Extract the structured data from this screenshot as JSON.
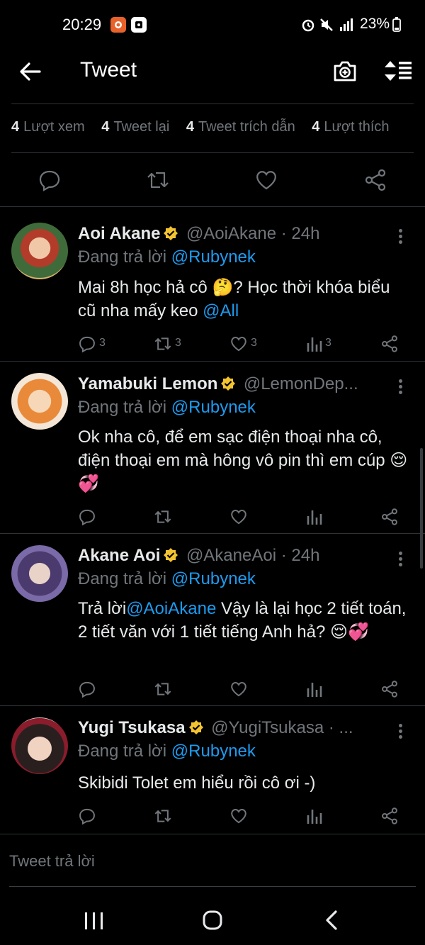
{
  "status_bar": {
    "time": "20:29",
    "battery": "23%"
  },
  "header": {
    "title": "Tweet"
  },
  "stats": [
    {
      "num": "4",
      "label": "Lượt xem"
    },
    {
      "num": "4",
      "label": "Tweet lại"
    },
    {
      "num": "4",
      "label": "Tweet trích dẫn"
    },
    {
      "num": "4",
      "label": "Lượt thích"
    }
  ],
  "replies": [
    {
      "name": "Aoi Akane",
      "handle": "@AoiAkane · 24h",
      "replying_prefix": "Đang trả lời ",
      "replying_to": "@Rubynek",
      "body_1": "Mai 8h học hả cô 🤔?  Học thời khóa biểu cũ nha mấy keo ",
      "body_mention": "@All",
      "reply_count": "3",
      "retweet_count": "3",
      "like_count": "3",
      "view_count": "3"
    },
    {
      "name": "Yamabuki Lemon",
      "handle": "@LemonDep...",
      "replying_prefix": "Đang trả lời ",
      "replying_to": "@Rubynek",
      "body_1": "Ok nha cô, để em sạc điện thoại nha cô, điện thoại em mà hông vô pin thì em cúp 😌💞"
    },
    {
      "name": "Akane Aoi",
      "handle": "@AkaneAoi · 24h",
      "replying_prefix": "Đang trả lời ",
      "replying_to": "@Rubynek",
      "body_prefix": "Trả lời",
      "body_mention": "@AoiAkane",
      "body_1": " Vậy là lại học 2 tiết toán, 2 tiết văn với 1 tiết tiếng Anh hả? 😌💞"
    },
    {
      "name": "Yugi Tsukasa",
      "handle": "@YugiTsukasa · ...",
      "replying_prefix": "Đang trả lời ",
      "replying_to": "@Rubynek",
      "body_1": "Skibidi Tolet em hiểu rồi cô ơi -)"
    }
  ],
  "reply_input": {
    "placeholder": "Tweet trả lời"
  },
  "colors": {
    "background": "#000000",
    "accent": "#1d9bf0",
    "muted": "#71767b",
    "verified": "#f4c430"
  }
}
